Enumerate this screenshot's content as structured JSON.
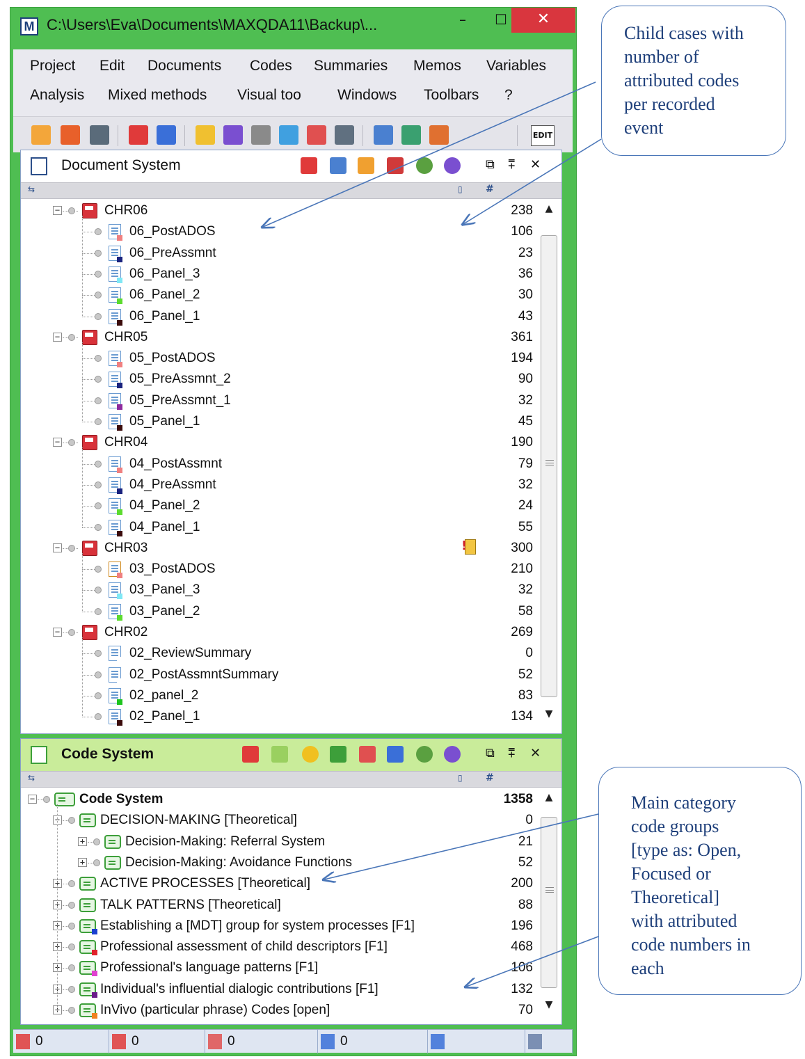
{
  "window": {
    "title": "C:\\Users\\Eva\\Documents\\MAXQDA11\\Backup\\...",
    "app_icon": "maxqda-icon",
    "controls": {
      "minimize": "–",
      "maximize": "☐",
      "close": "✕"
    }
  },
  "menubar": {
    "row1": [
      "Project",
      "Edit",
      "Documents",
      "Codes",
      "Summaries",
      "Memos",
      "Variables"
    ],
    "row2": [
      "Analysis",
      "Mixed methods",
      "Visual too",
      "Windows",
      "Toolbars",
      "?"
    ]
  },
  "toolbar": {
    "icons": [
      "new-project-icon",
      "open-project-icon",
      "export-icon",
      "code-matrix-icon",
      "refresh-icon",
      "document-icon",
      "search-icon",
      "filter-icon",
      "activate-icon",
      "network-icon",
      "list-icon",
      "table-icon",
      "table-edit-icon",
      "chart-icon"
    ],
    "edit_label": "EDIT"
  },
  "document_system": {
    "title": "Document System",
    "column_hash": "#",
    "items": [
      {
        "level": 0,
        "type": "case",
        "label": "CHR06",
        "count": "238"
      },
      {
        "level": 1,
        "type": "doc",
        "label": "06_PostADOS",
        "count": "106",
        "swatch": "#f08080"
      },
      {
        "level": 1,
        "type": "doc",
        "label": "06_PreAssmnt",
        "count": "23",
        "swatch": "#1a237e"
      },
      {
        "level": 1,
        "type": "doc",
        "label": "06_Panel_3",
        "count": "36",
        "swatch": "#80e8f5"
      },
      {
        "level": 1,
        "type": "doc",
        "label": "06_Panel_2",
        "count": "30",
        "swatch": "#5cdb2e"
      },
      {
        "level": 1,
        "type": "doc",
        "label": "06_Panel_1",
        "count": "43",
        "swatch": "#3b0c0c"
      },
      {
        "level": 0,
        "type": "case",
        "label": "CHR05",
        "count": "361"
      },
      {
        "level": 1,
        "type": "doc",
        "label": "05_PostADOS",
        "count": "194",
        "swatch": "#f08080"
      },
      {
        "level": 1,
        "type": "doc",
        "label": "05_PreAssmnt_2",
        "count": "90",
        "swatch": "#1a237e"
      },
      {
        "level": 1,
        "type": "doc",
        "label": "05_PreAssmnt_1",
        "count": "32",
        "swatch": "#8e2a9e"
      },
      {
        "level": 1,
        "type": "doc",
        "label": "05_Panel_1",
        "count": "45",
        "swatch": "#3b0c0c"
      },
      {
        "level": 0,
        "type": "case",
        "label": "CHR04",
        "count": "190"
      },
      {
        "level": 1,
        "type": "doc",
        "label": "04_PostAssmnt",
        "count": "79",
        "swatch": "#f08080"
      },
      {
        "level": 1,
        "type": "doc",
        "label": "04_PreAssmnt",
        "count": "32",
        "swatch": "#1a237e"
      },
      {
        "level": 1,
        "type": "doc",
        "label": "04_Panel_2",
        "count": "24",
        "swatch": "#5cdb2e"
      },
      {
        "level": 1,
        "type": "doc",
        "label": "04_Panel_1",
        "count": "55",
        "swatch": "#3b0c0c"
      },
      {
        "level": 0,
        "type": "case",
        "label": "CHR03",
        "count": "300",
        "memo": true
      },
      {
        "level": 1,
        "type": "doc-edit",
        "label": "03_PostADOS",
        "count": "210",
        "swatch": "#f08080"
      },
      {
        "level": 1,
        "type": "doc",
        "label": "03_Panel_3",
        "count": "32",
        "swatch": "#80e8f5"
      },
      {
        "level": 1,
        "type": "doc",
        "label": "03_Panel_2",
        "count": "58",
        "swatch": "#5cdb2e"
      },
      {
        "level": 0,
        "type": "case",
        "label": "CHR02",
        "count": "269"
      },
      {
        "level": 1,
        "type": "doc",
        "label": "02_ReviewSummary",
        "count": "0",
        "swatch": "#ffffff"
      },
      {
        "level": 1,
        "type": "doc",
        "label": "02_PostAssmntSummary",
        "count": "52",
        "swatch": "#ffffff"
      },
      {
        "level": 1,
        "type": "doc",
        "label": "02_panel_2",
        "count": "83",
        "swatch": "#1ec41e"
      },
      {
        "level": 1,
        "type": "doc",
        "label": "02_Panel_1",
        "count": "134",
        "swatch": "#3b0c0c"
      }
    ]
  },
  "code_system": {
    "title": "Code System",
    "column_hash": "#",
    "items": [
      {
        "level": 0,
        "label": "Code System",
        "count": "1358",
        "bold": true,
        "expander": "−"
      },
      {
        "level": 1,
        "label": "DECISION-MAKING [Theoretical]",
        "count": "0",
        "expander": "−"
      },
      {
        "level": 2,
        "label": "Decision-Making: Referral System",
        "count": "21",
        "expander": "+"
      },
      {
        "level": 2,
        "label": "Decision-Making: Avoidance Functions",
        "count": "52",
        "expander": "+"
      },
      {
        "level": 1,
        "label": "ACTIVE PROCESSES [Theoretical]",
        "count": "200",
        "expander": "+"
      },
      {
        "level": 1,
        "label": "TALK PATTERNS [Theoretical]",
        "count": "88",
        "expander": "+"
      },
      {
        "level": 1,
        "label": "Establishing a [MDT] group for system processes [F1]",
        "count": "196",
        "expander": "+",
        "swatch": "#1a3fd0"
      },
      {
        "level": 1,
        "label": "Professional assessment of child descriptors [F1]",
        "count": "468",
        "expander": "+",
        "swatch": "#e0202a"
      },
      {
        "level": 1,
        "label": "Professional's language patterns [F1]",
        "count": "106",
        "expander": "+",
        "swatch": "#e040d0"
      },
      {
        "level": 1,
        "label": "Individual's influential dialogic contributions [F1]",
        "count": "132",
        "expander": "+",
        "swatch": "#6a1a8a"
      },
      {
        "level": 1,
        "label": "InVivo (particular phrase) Codes [open]",
        "count": "70",
        "expander": "+",
        "swatch": "#f08020"
      }
    ]
  },
  "statusbar": [
    {
      "icon": "documents-icon",
      "value": "0"
    },
    {
      "icon": "codes-icon",
      "value": "0"
    },
    {
      "icon": "coded-segments-icon",
      "value": "0"
    },
    {
      "icon": "weight-icon",
      "value": "0"
    },
    {
      "icon": "user-icon",
      "value": ""
    },
    {
      "icon": "filter-off-icon",
      "value": ""
    }
  ],
  "callouts": {
    "top": [
      "Child cases with",
      "number of",
      "attributed codes",
      "per recorded",
      "event"
    ],
    "bottom": [
      "Main category",
      "code groups",
      "[type as: Open,",
      "Focused or",
      "Theoretical]",
      "with attributed",
      "code numbers in",
      "each"
    ]
  },
  "colors": {
    "window_frame": "#4fbe52",
    "close_button": "#d9363e",
    "callout_border": "#4a76b8",
    "callout_text": "#1e3f7a"
  }
}
